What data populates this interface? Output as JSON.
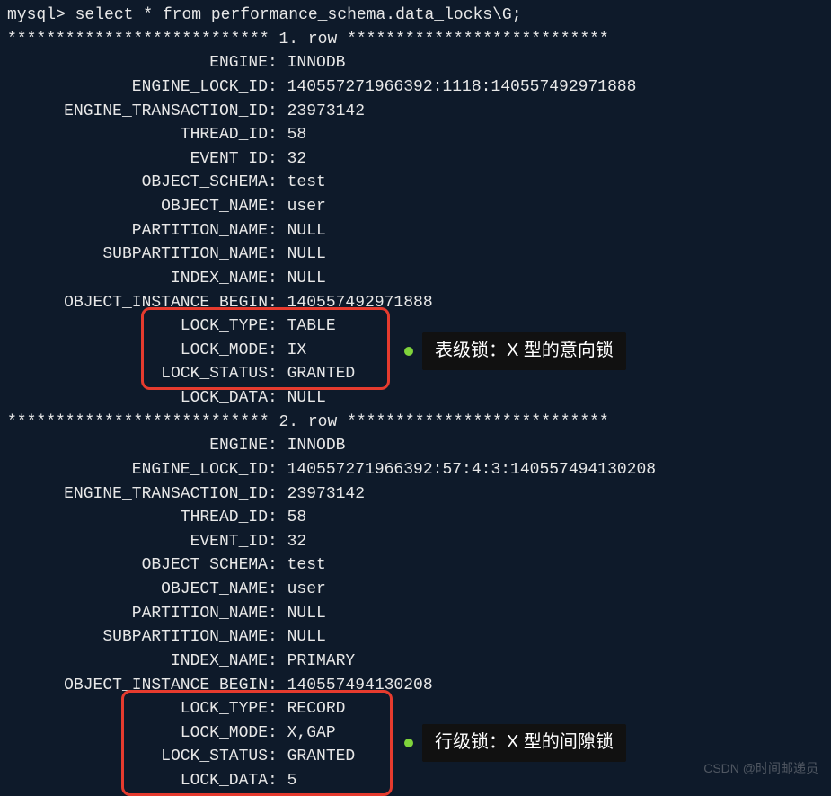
{
  "prompt": "mysql> ",
  "query": "select * from performance_schema.data_locks\\G;",
  "row_sep_prefix": "*************************** ",
  "row_sep_mid": ". row ",
  "row_sep_suffix": "***************************",
  "rows": [
    {
      "n": "1",
      "fields": [
        {
          "k": "ENGINE",
          "v": "INNODB"
        },
        {
          "k": "ENGINE_LOCK_ID",
          "v": "140557271966392:1118:140557492971888"
        },
        {
          "k": "ENGINE_TRANSACTION_ID",
          "v": "23973142"
        },
        {
          "k": "THREAD_ID",
          "v": "58"
        },
        {
          "k": "EVENT_ID",
          "v": "32"
        },
        {
          "k": "OBJECT_SCHEMA",
          "v": "test"
        },
        {
          "k": "OBJECT_NAME",
          "v": "user"
        },
        {
          "k": "PARTITION_NAME",
          "v": "NULL"
        },
        {
          "k": "SUBPARTITION_NAME",
          "v": "NULL"
        },
        {
          "k": "INDEX_NAME",
          "v": "NULL"
        },
        {
          "k": "OBJECT_INSTANCE_BEGIN",
          "v": "140557492971888"
        },
        {
          "k": "LOCK_TYPE",
          "v": "TABLE"
        },
        {
          "k": "LOCK_MODE",
          "v": "IX"
        },
        {
          "k": "LOCK_STATUS",
          "v": "GRANTED"
        },
        {
          "k": "LOCK_DATA",
          "v": "NULL"
        }
      ]
    },
    {
      "n": "2",
      "fields": [
        {
          "k": "ENGINE",
          "v": "INNODB"
        },
        {
          "k": "ENGINE_LOCK_ID",
          "v": "140557271966392:57:4:3:140557494130208"
        },
        {
          "k": "ENGINE_TRANSACTION_ID",
          "v": "23973142"
        },
        {
          "k": "THREAD_ID",
          "v": "58"
        },
        {
          "k": "EVENT_ID",
          "v": "32"
        },
        {
          "k": "OBJECT_SCHEMA",
          "v": "test"
        },
        {
          "k": "OBJECT_NAME",
          "v": "user"
        },
        {
          "k": "PARTITION_NAME",
          "v": "NULL"
        },
        {
          "k": "SUBPARTITION_NAME",
          "v": "NULL"
        },
        {
          "k": "INDEX_NAME",
          "v": "PRIMARY"
        },
        {
          "k": "OBJECT_INSTANCE_BEGIN",
          "v": "140557494130208"
        },
        {
          "k": "LOCK_TYPE",
          "v": "RECORD"
        },
        {
          "k": "LOCK_MODE",
          "v": "X,GAP"
        },
        {
          "k": "LOCK_STATUS",
          "v": "GRANTED"
        },
        {
          "k": "LOCK_DATA",
          "v": "5"
        }
      ]
    }
  ],
  "annotations": [
    {
      "text": "表级锁：X 型的意向锁"
    },
    {
      "text": "行级锁：X 型的间隙锁"
    }
  ],
  "watermark": "CSDN @时间邮递员"
}
